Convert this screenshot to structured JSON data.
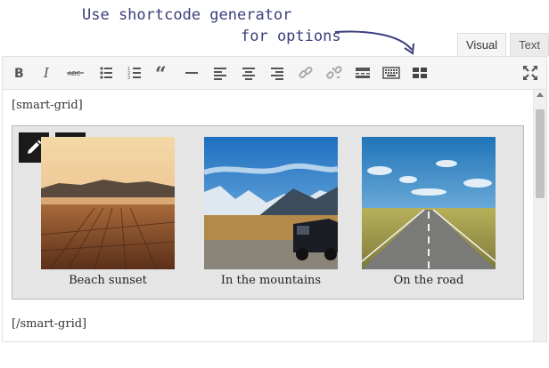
{
  "annotation": {
    "line1": "Use shortcode generator",
    "line2": "for options"
  },
  "tabs": [
    {
      "label": "Visual",
      "active": true
    },
    {
      "label": "Text",
      "active": false
    }
  ],
  "toolbar": {
    "buttons": [
      "bold",
      "italic",
      "strikethrough",
      "bullet-list",
      "numbered-list",
      "blockquote",
      "horizontal-line",
      "align-left",
      "align-center",
      "align-right",
      "link",
      "unlink",
      "read-more",
      "toolbar-toggle",
      "shortcode-generator",
      "fullscreen"
    ]
  },
  "content": {
    "shortcode_open": "[smart-grid]",
    "shortcode_close": "[/smart-grid]",
    "items": [
      {
        "caption": "Beach sunset"
      },
      {
        "caption": "In the mountains"
      },
      {
        "caption": "On the road"
      }
    ]
  },
  "colors": {
    "annotation": "#3b3e7a",
    "toolbar_bg": "#f5f5f5",
    "grid_bg": "#e5e5e5",
    "overlay_button": "#1a1a1a"
  }
}
